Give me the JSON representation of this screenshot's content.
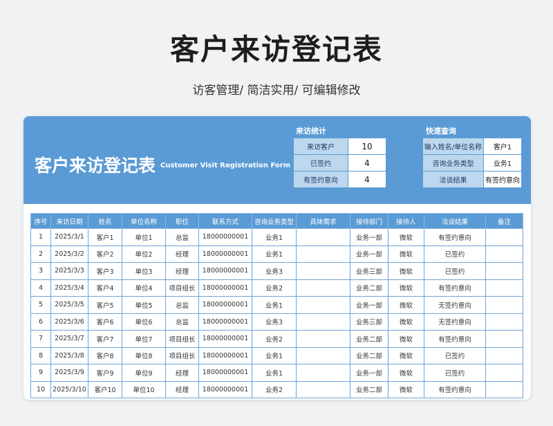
{
  "page": {
    "title": "客户来访登记表",
    "subtitle": "访客管理/ 简洁实用/ 可编辑修改"
  },
  "banner": {
    "title_cn": "客户来访登记表",
    "title_en": "Customer Visit Registration Form"
  },
  "stats": {
    "heading": "来访统计",
    "rows": [
      {
        "label": "来访客户",
        "value": "10"
      },
      {
        "label": "已签约",
        "value": "4"
      },
      {
        "label": "有签约意向",
        "value": "4"
      }
    ]
  },
  "query": {
    "heading": "快速查询",
    "rows": [
      {
        "label": "输入姓名/单位名称",
        "value": "客户1"
      },
      {
        "label": "咨询业务类型",
        "value": "业务1"
      },
      {
        "label": "洽谈结果",
        "value": "有签约意向"
      }
    ]
  },
  "table": {
    "headers": [
      "序号",
      "来访日期",
      "姓名",
      "单位名称",
      "职位",
      "联系方式",
      "咨询业务类型",
      "具体需求",
      "接待部门",
      "接待人",
      "洽谈结果",
      "备注"
    ],
    "rows": [
      [
        "1",
        "2025/3/1",
        "客户1",
        "单位1",
        "总监",
        "18000000001",
        "业务1",
        "",
        "业务一部",
        "微软",
        "有签约意向",
        ""
      ],
      [
        "2",
        "2025/3/2",
        "客户2",
        "单位2",
        "经理",
        "18000000001",
        "业务1",
        "",
        "业务一部",
        "微软",
        "已签约",
        ""
      ],
      [
        "3",
        "2025/3/3",
        "客户3",
        "单位3",
        "经理",
        "18000000001",
        "业务3",
        "",
        "业务三部",
        "微软",
        "已签约",
        ""
      ],
      [
        "4",
        "2025/3/4",
        "客户4",
        "单位4",
        "项目组长",
        "18000000001",
        "业务2",
        "",
        "业务二部",
        "微软",
        "有签约意向",
        ""
      ],
      [
        "5",
        "2025/3/5",
        "客户5",
        "单位5",
        "总监",
        "18000000001",
        "业务1",
        "",
        "业务一部",
        "微软",
        "无签约意向",
        ""
      ],
      [
        "6",
        "2025/3/6",
        "客户6",
        "单位6",
        "总监",
        "18000000001",
        "业务3",
        "",
        "业务三部",
        "微软",
        "无签约意向",
        ""
      ],
      [
        "7",
        "2025/3/7",
        "客户7",
        "单位7",
        "项目组长",
        "18000000001",
        "业务2",
        "",
        "业务二部",
        "微软",
        "有签约意向",
        ""
      ],
      [
        "8",
        "2025/3/8",
        "客户8",
        "单位8",
        "项目组长",
        "18000000001",
        "业务1",
        "",
        "业务二部",
        "微软",
        "已签约",
        ""
      ],
      [
        "9",
        "2025/3/9",
        "客户9",
        "单位9",
        "经理",
        "18000000001",
        "业务1",
        "",
        "业务一部",
        "微软",
        "已签约",
        ""
      ],
      [
        "10",
        "2025/3/10",
        "客户10",
        "单位10",
        "经理",
        "18000000001",
        "业务2",
        "",
        "业务二部",
        "微软",
        "有签约意向",
        ""
      ]
    ]
  }
}
